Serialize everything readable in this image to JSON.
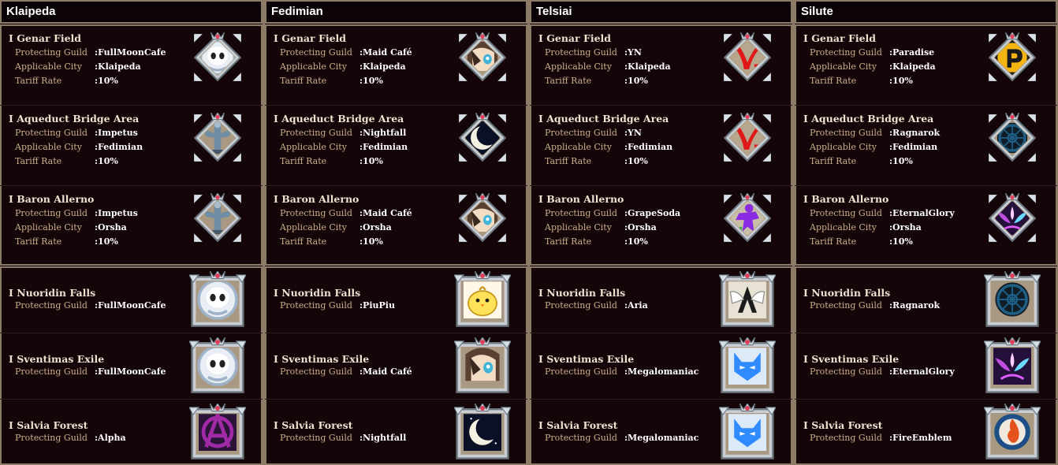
{
  "labels": {
    "protecting_guild": "Protecting Guild",
    "applicable_city": "Applicable City",
    "tariff_rate": "Tariff Rate"
  },
  "columns": [
    {
      "title": "Klaipeda",
      "territories": [
        {
          "name": "I Genar Field",
          "guild": ":FullMoonCafe",
          "city": ":Klaipeda",
          "tariff": ":10%",
          "emblem": "ghost-emblem",
          "color": "#9fb2c8"
        },
        {
          "name": "I Aqueduct Bridge Area",
          "guild": ":Impetus",
          "city": ":Fedimian",
          "tariff": ":10%",
          "emblem": "statue-emblem",
          "color": "#6f8da4"
        },
        {
          "name": "I Baron Allerno",
          "guild": ":Impetus",
          "city": ":Orsha",
          "tariff": ":10%",
          "emblem": "statue-emblem",
          "color": "#6f8da4"
        }
      ],
      "zones": [
        {
          "name": "I Nuoridin Falls",
          "guild": ":FullMoonCafe",
          "emblem": "ghost-emblem",
          "color": "#9fb2c8"
        },
        {
          "name": "I Sventimas Exile",
          "guild": ":FullMoonCafe",
          "emblem": "ghost-emblem",
          "color": "#9fb2c8"
        },
        {
          "name": "I Salvia Forest",
          "guild": ":Alpha",
          "emblem": "anarchy-emblem",
          "color": "#a02aa6"
        }
      ]
    },
    {
      "title": "Fedimian",
      "territories": [
        {
          "name": "I Genar Field",
          "guild": ":Maid Café",
          "city": ":Klaipeda",
          "tariff": ":10%",
          "emblem": "anime-girl-emblem",
          "color": "#d9c8a8"
        },
        {
          "name": "I Aqueduct Bridge Area",
          "guild": ":Nightfall",
          "city": ":Fedimian",
          "tariff": ":10%",
          "emblem": "moon-emblem",
          "color": "#0a1026"
        },
        {
          "name": "I Baron Allerno",
          "guild": ":Maid Café",
          "city": ":Orsha",
          "tariff": ":10%",
          "emblem": "anime-girl-emblem",
          "color": "#d9c8a8"
        }
      ],
      "zones": [
        {
          "name": "I Nuoridin Falls",
          "guild": ":PiuPiu",
          "emblem": "chick-emblem",
          "color": "#ffe25a"
        },
        {
          "name": "I Sventimas Exile",
          "guild": ":Maid Café",
          "emblem": "anime-girl-emblem",
          "color": "#d9c8a8"
        },
        {
          "name": "I Salvia Forest",
          "guild": ":Nightfall",
          "emblem": "moon-emblem",
          "color": "#0a1026"
        }
      ]
    },
    {
      "title": "Telsiai",
      "territories": [
        {
          "name": "I Genar Field",
          "guild": ":YN",
          "city": ":Klaipeda",
          "tariff": ":10%",
          "emblem": "yn-logo-emblem",
          "color": "#e01818"
        },
        {
          "name": "I Aqueduct Bridge Area",
          "guild": ":YN",
          "city": ":Fedimian",
          "tariff": ":10%",
          "emblem": "yn-logo-emblem",
          "color": "#e01818"
        },
        {
          "name": "I Baron Allerno",
          "guild": ":GrapeSoda",
          "city": ":Orsha",
          "tariff": ":10%",
          "emblem": "purple-figure-emblem",
          "color": "#8a2be2"
        }
      ],
      "zones": [
        {
          "name": "I Nuoridin Falls",
          "guild": ":Aria",
          "emblem": "winged-a-emblem",
          "color": "#e8e2d4"
        },
        {
          "name": "I Sventimas Exile",
          "guild": ":Megalomaniac",
          "emblem": "blue-wolf-emblem",
          "color": "#2f8bff"
        },
        {
          "name": "I Salvia Forest",
          "guild": ":Megalomaniac",
          "emblem": "blue-wolf-emblem",
          "color": "#2f8bff"
        }
      ]
    },
    {
      "title": "Silute",
      "territories": [
        {
          "name": "I Genar Field",
          "guild": ":Paradise",
          "city": ":Klaipeda",
          "tariff": ":10%",
          "emblem": "p-logo-emblem",
          "color": "#f4b512"
        },
        {
          "name": "I Aqueduct Bridge Area",
          "guild": ":Ragnarok",
          "city": ":Fedimian",
          "tariff": ":10%",
          "emblem": "rune-wheel-emblem",
          "color": "#1f5f86"
        },
        {
          "name": "I Baron Allerno",
          "guild": ":EternalGlory",
          "city": ":Orsha",
          "tariff": ":10%",
          "emblem": "flame-wings-emblem",
          "color": "#c04fe0"
        }
      ],
      "zones": [
        {
          "name": "I Nuoridin Falls",
          "guild": ":Ragnarok",
          "emblem": "rune-wheel-emblem",
          "color": "#1f5f86"
        },
        {
          "name": "I Sventimas Exile",
          "guild": ":EternalGlory",
          "emblem": "flame-wings-emblem",
          "color": "#c04fe0"
        },
        {
          "name": "I Salvia Forest",
          "guild": ":FireEmblem",
          "emblem": "fire-emblem",
          "color": "#e5531c"
        }
      ]
    }
  ]
}
